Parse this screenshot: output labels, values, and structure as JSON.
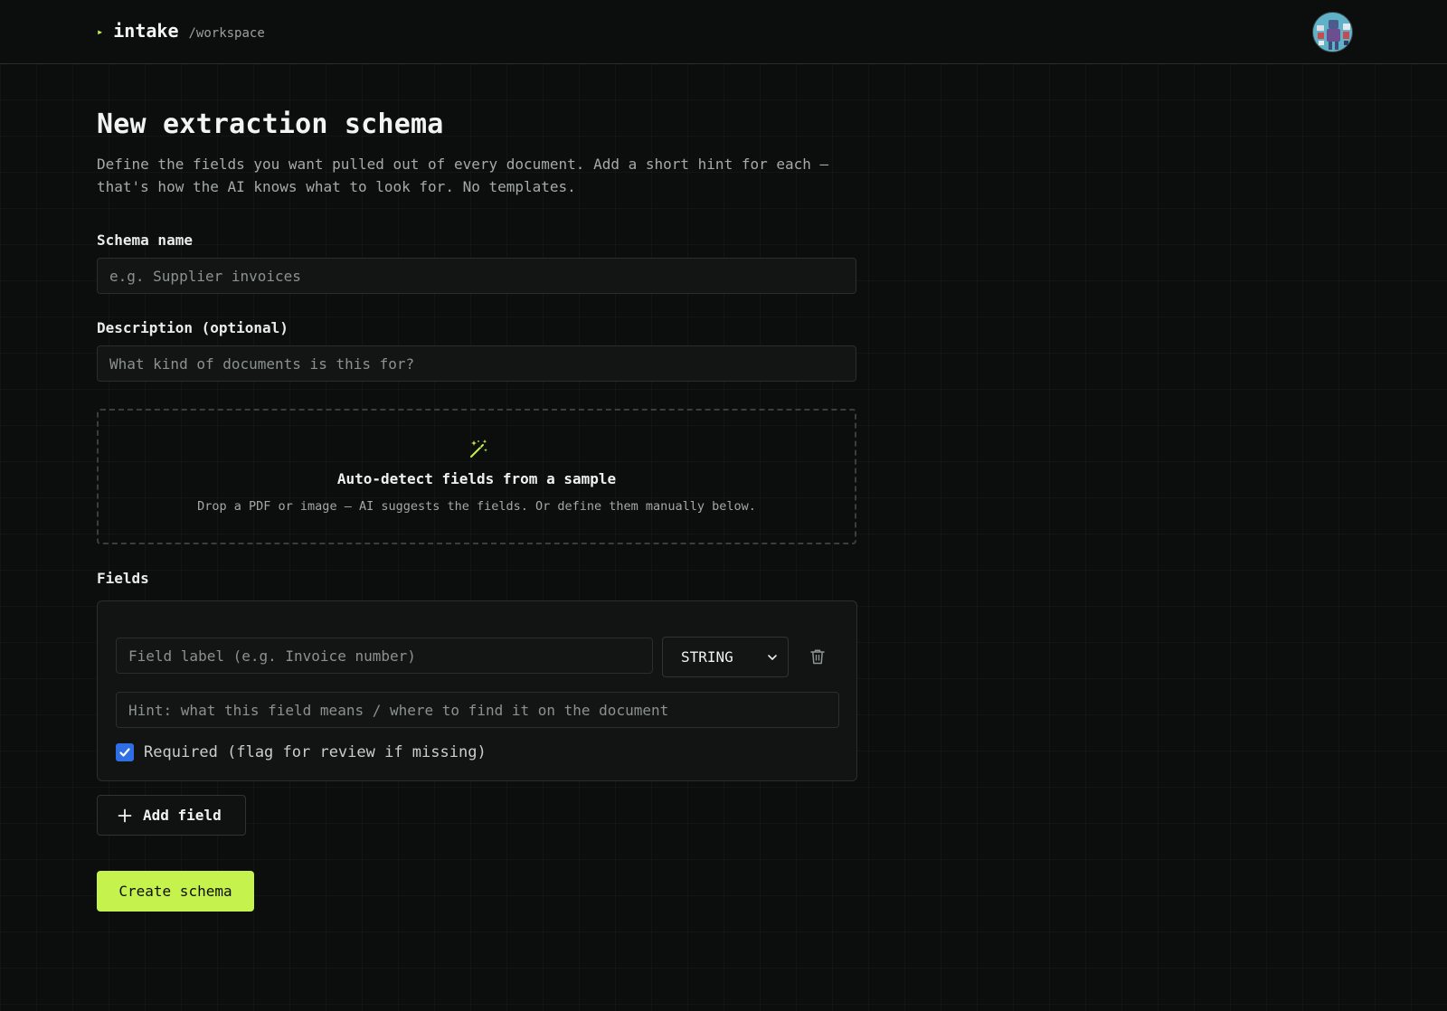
{
  "header": {
    "caret": "▸",
    "brand": "intake",
    "path": "/workspace"
  },
  "page": {
    "title": "New extraction schema",
    "subtitle": "Define the fields you want pulled out of every document. Add a short hint for each — that's how the AI knows what to look for. No templates."
  },
  "form": {
    "schema_name": {
      "label": "Schema name",
      "value": "",
      "placeholder": "e.g. Supplier invoices"
    },
    "description": {
      "label": "Description (optional)",
      "value": "",
      "placeholder": "What kind of documents is this for?"
    }
  },
  "dropzone": {
    "icon": "magic-wand-icon",
    "title": "Auto-detect fields from a sample",
    "subtitle": "Drop a PDF or image — AI suggests the fields. Or define them manually below."
  },
  "fields": {
    "section_label": "Fields",
    "items": [
      {
        "label_value": "",
        "label_placeholder": "Field label (e.g. Invoice number)",
        "type": "STRING",
        "hint_value": "",
        "hint_placeholder": "Hint: what this field means / where to find it on the document",
        "required": true,
        "required_label": "Required (flag for review if missing)"
      }
    ],
    "add_label": "Add field"
  },
  "actions": {
    "create_label": "Create schema"
  },
  "colors": {
    "accent": "#c6f24e",
    "background": "#0c0e0d",
    "checkbox": "#2f6fe6"
  }
}
